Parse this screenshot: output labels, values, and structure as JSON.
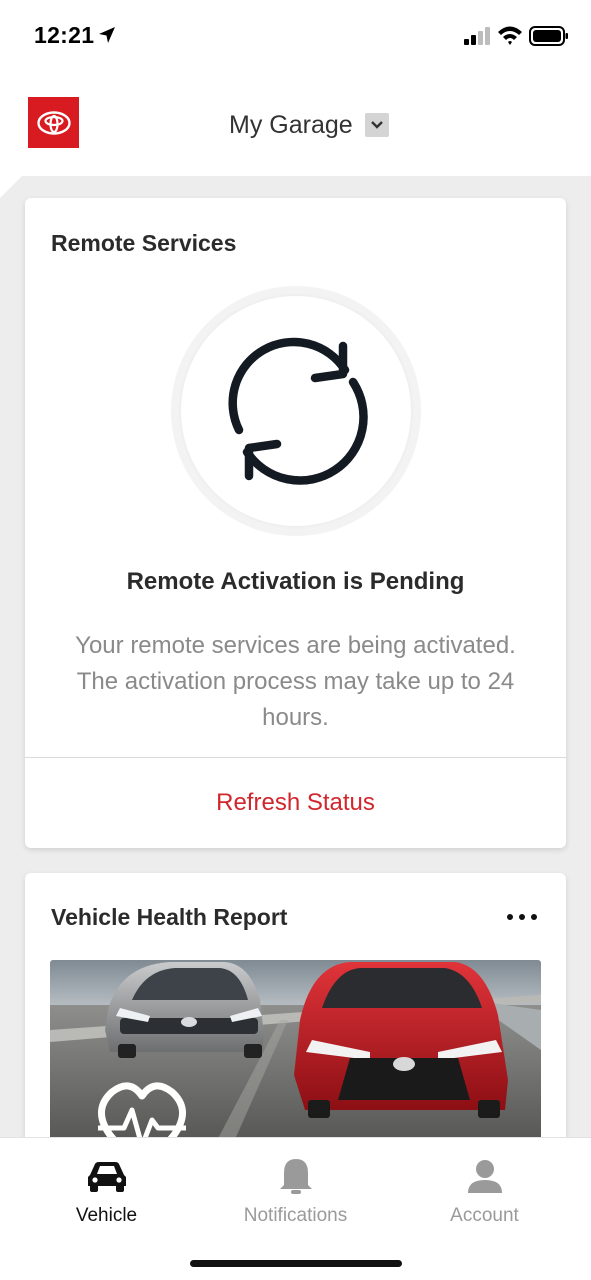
{
  "status_bar": {
    "time": "12:21",
    "icons": [
      "location-arrow-icon",
      "cellular-signal-icon",
      "wifi-icon",
      "battery-icon"
    ]
  },
  "header": {
    "logo": "toyota-logo",
    "title": "My Garage",
    "dropdown_icon": "chevron-down-icon"
  },
  "remote_services": {
    "title": "Remote Services",
    "icon": "refresh-icon",
    "status_title": "Remote Activation is Pending",
    "status_description": "Your remote services are being activated. The activation process may take up to 24 hours.",
    "action_label": "Refresh Status"
  },
  "vehicle_health": {
    "title": "Vehicle Health Report",
    "menu_icon": "more-horizontal-icon",
    "image": "vehicle-health-car-image",
    "overlay_icon": "heart-pulse-icon"
  },
  "tab_bar": {
    "tabs": [
      {
        "label": "Vehicle",
        "icon": "car-icon",
        "active": true
      },
      {
        "label": "Notifications",
        "icon": "bell-icon",
        "active": false
      },
      {
        "label": "Account",
        "icon": "person-icon",
        "active": false
      }
    ]
  },
  "colors": {
    "brand_red": "#d71b21",
    "action_red": "#d0272d",
    "background_grey": "#ededed",
    "inactive_grey": "#9a9a9a"
  }
}
